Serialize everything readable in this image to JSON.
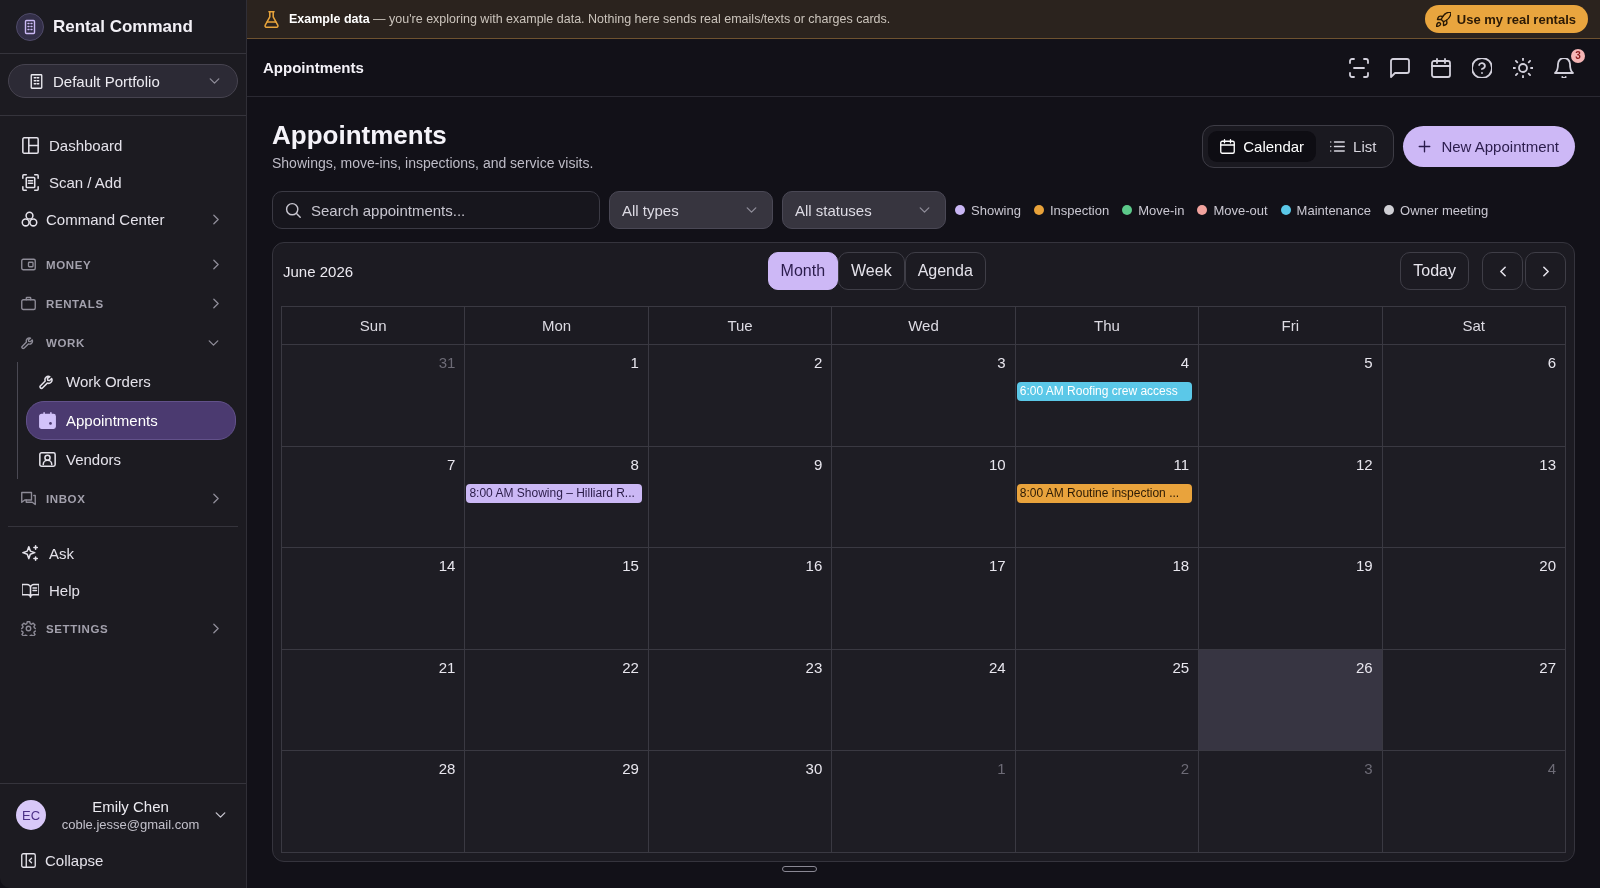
{
  "banner": {
    "text": "**Example data** — you're exploring with example data. Nothing here sends real emails/texts or charges cards.",
    "button": "Use my real rentals"
  },
  "sidebar": {
    "brand": "Rental Command",
    "portfolio": "Default Portfolio",
    "nav": [
      {
        "kind": "link",
        "label": "Dashboard",
        "selected": false
      },
      {
        "kind": "link",
        "label": "Scan / Add",
        "selected": false
      },
      {
        "kind": "menu",
        "label": "Command Center",
        "selected": false,
        "expanded": false
      },
      {
        "kind": "section",
        "label": "MONEY",
        "selected": false,
        "expanded": false
      },
      {
        "kind": "section",
        "label": "RENTALS",
        "selected": false,
        "expanded": false
      },
      {
        "kind": "section",
        "label": "WORK",
        "selected": false,
        "expanded": true,
        "children": [
          {
            "label": "Work Orders",
            "selected": false
          },
          {
            "label": "Appointments",
            "selected": true
          },
          {
            "label": "Vendors",
            "selected": false
          }
        ]
      },
      {
        "kind": "section",
        "label": "INBOX",
        "selected": false,
        "expanded": false
      }
    ],
    "nav_bottom": [
      {
        "kind": "link",
        "label": "Ask",
        "selected": false
      },
      {
        "kind": "link",
        "label": "Help",
        "selected": false
      },
      {
        "kind": "section",
        "label": "SETTINGS",
        "selected": false,
        "expanded": false
      }
    ],
    "user": {
      "initials": "EC",
      "name": "Emily Chen",
      "email": "coble.jesse@gmail.com"
    },
    "collapse": "Collapse"
  },
  "topbar": {
    "title": "Appointments",
    "notification_count": "3"
  },
  "page": {
    "title": "Appointments",
    "subtitle": "Showings, move-ins, inspections, and service visits.",
    "view_toggle": [
      {
        "label": "Calendar",
        "selected": true
      },
      {
        "label": "List",
        "selected": false
      }
    ],
    "new_button": "New Appointment"
  },
  "filters": {
    "search": {
      "placeholder": "Search appointments..."
    },
    "selects": [
      {
        "value": "All types"
      },
      {
        "value": "All statuses"
      }
    ],
    "legend": [
      {
        "label": "Showing",
        "color": "#c9b6f4"
      },
      {
        "label": "Inspection",
        "color": "#e8a23a"
      },
      {
        "label": "Move-in",
        "color": "#5cc98a"
      },
      {
        "label": "Move-out",
        "color": "#f2a39e"
      },
      {
        "label": "Maintenance",
        "color": "#5bc8e8"
      },
      {
        "label": "Owner meeting",
        "color": "#cfcfd4"
      }
    ]
  },
  "calendar": {
    "month_label": "June 2026",
    "views": [
      {
        "label": "Month",
        "selected": true
      },
      {
        "label": "Week",
        "selected": false
      },
      {
        "label": "Agenda",
        "selected": false
      }
    ],
    "today_button": "Today",
    "weekdays": [
      "Sun",
      "Mon",
      "Tue",
      "Wed",
      "Thu",
      "Fri",
      "Sat"
    ],
    "weeks": [
      {
        "days": [
          {
            "day": "31",
            "in_month": false,
            "today": false
          },
          {
            "day": "1",
            "in_month": true,
            "today": false
          },
          {
            "day": "2",
            "in_month": true,
            "today": false
          },
          {
            "day": "3",
            "in_month": true,
            "today": false
          },
          {
            "day": "4",
            "in_month": true,
            "today": false,
            "events": [
              {
                "kind": "maintenance",
                "label": "6:00 AM Roofing crew access",
                "color": "#5bc8e8"
              }
            ]
          },
          {
            "day": "5",
            "in_month": true,
            "today": false
          },
          {
            "day": "6",
            "in_month": true,
            "today": false
          }
        ]
      },
      {
        "days": [
          {
            "day": "7",
            "in_month": true,
            "today": false
          },
          {
            "day": "8",
            "in_month": true,
            "today": false,
            "events": [
              {
                "kind": "showing",
                "label": "8:00 AM Showing – Hilliard R...",
                "color": "#cbb8f5"
              }
            ]
          },
          {
            "day": "9",
            "in_month": true,
            "today": false
          },
          {
            "day": "10",
            "in_month": true,
            "today": false
          },
          {
            "day": "11",
            "in_month": true,
            "today": false,
            "events": [
              {
                "kind": "inspection",
                "label": "8:00 AM Routine inspection ...",
                "color": "#e9a33c"
              }
            ]
          },
          {
            "day": "12",
            "in_month": true,
            "today": false
          },
          {
            "day": "13",
            "in_month": true,
            "today": false
          }
        ]
      },
      {
        "days": [
          {
            "day": "14",
            "in_month": true,
            "today": false
          },
          {
            "day": "15",
            "in_month": true,
            "today": false
          },
          {
            "day": "16",
            "in_month": true,
            "today": false
          },
          {
            "day": "17",
            "in_month": true,
            "today": false
          },
          {
            "day": "18",
            "in_month": true,
            "today": false
          },
          {
            "day": "19",
            "in_month": true,
            "today": false
          },
          {
            "day": "20",
            "in_month": true,
            "today": false
          }
        ]
      },
      {
        "days": [
          {
            "day": "21",
            "in_month": true,
            "today": false
          },
          {
            "day": "22",
            "in_month": true,
            "today": false
          },
          {
            "day": "23",
            "in_month": true,
            "today": false
          },
          {
            "day": "24",
            "in_month": true,
            "today": false
          },
          {
            "day": "25",
            "in_month": true,
            "today": false
          },
          {
            "day": "26",
            "in_month": true,
            "today": true
          },
          {
            "day": "27",
            "in_month": true,
            "today": false
          }
        ]
      },
      {
        "days": [
          {
            "day": "28",
            "in_month": true,
            "today": false
          },
          {
            "day": "29",
            "in_month": true,
            "today": false
          },
          {
            "day": "30",
            "in_month": true,
            "today": false
          },
          {
            "day": "1",
            "in_month": false,
            "today": false
          },
          {
            "day": "2",
            "in_month": false,
            "today": false
          },
          {
            "day": "3",
            "in_month": false,
            "today": false
          },
          {
            "day": "4",
            "in_month": false,
            "today": false
          }
        ]
      }
    ]
  }
}
